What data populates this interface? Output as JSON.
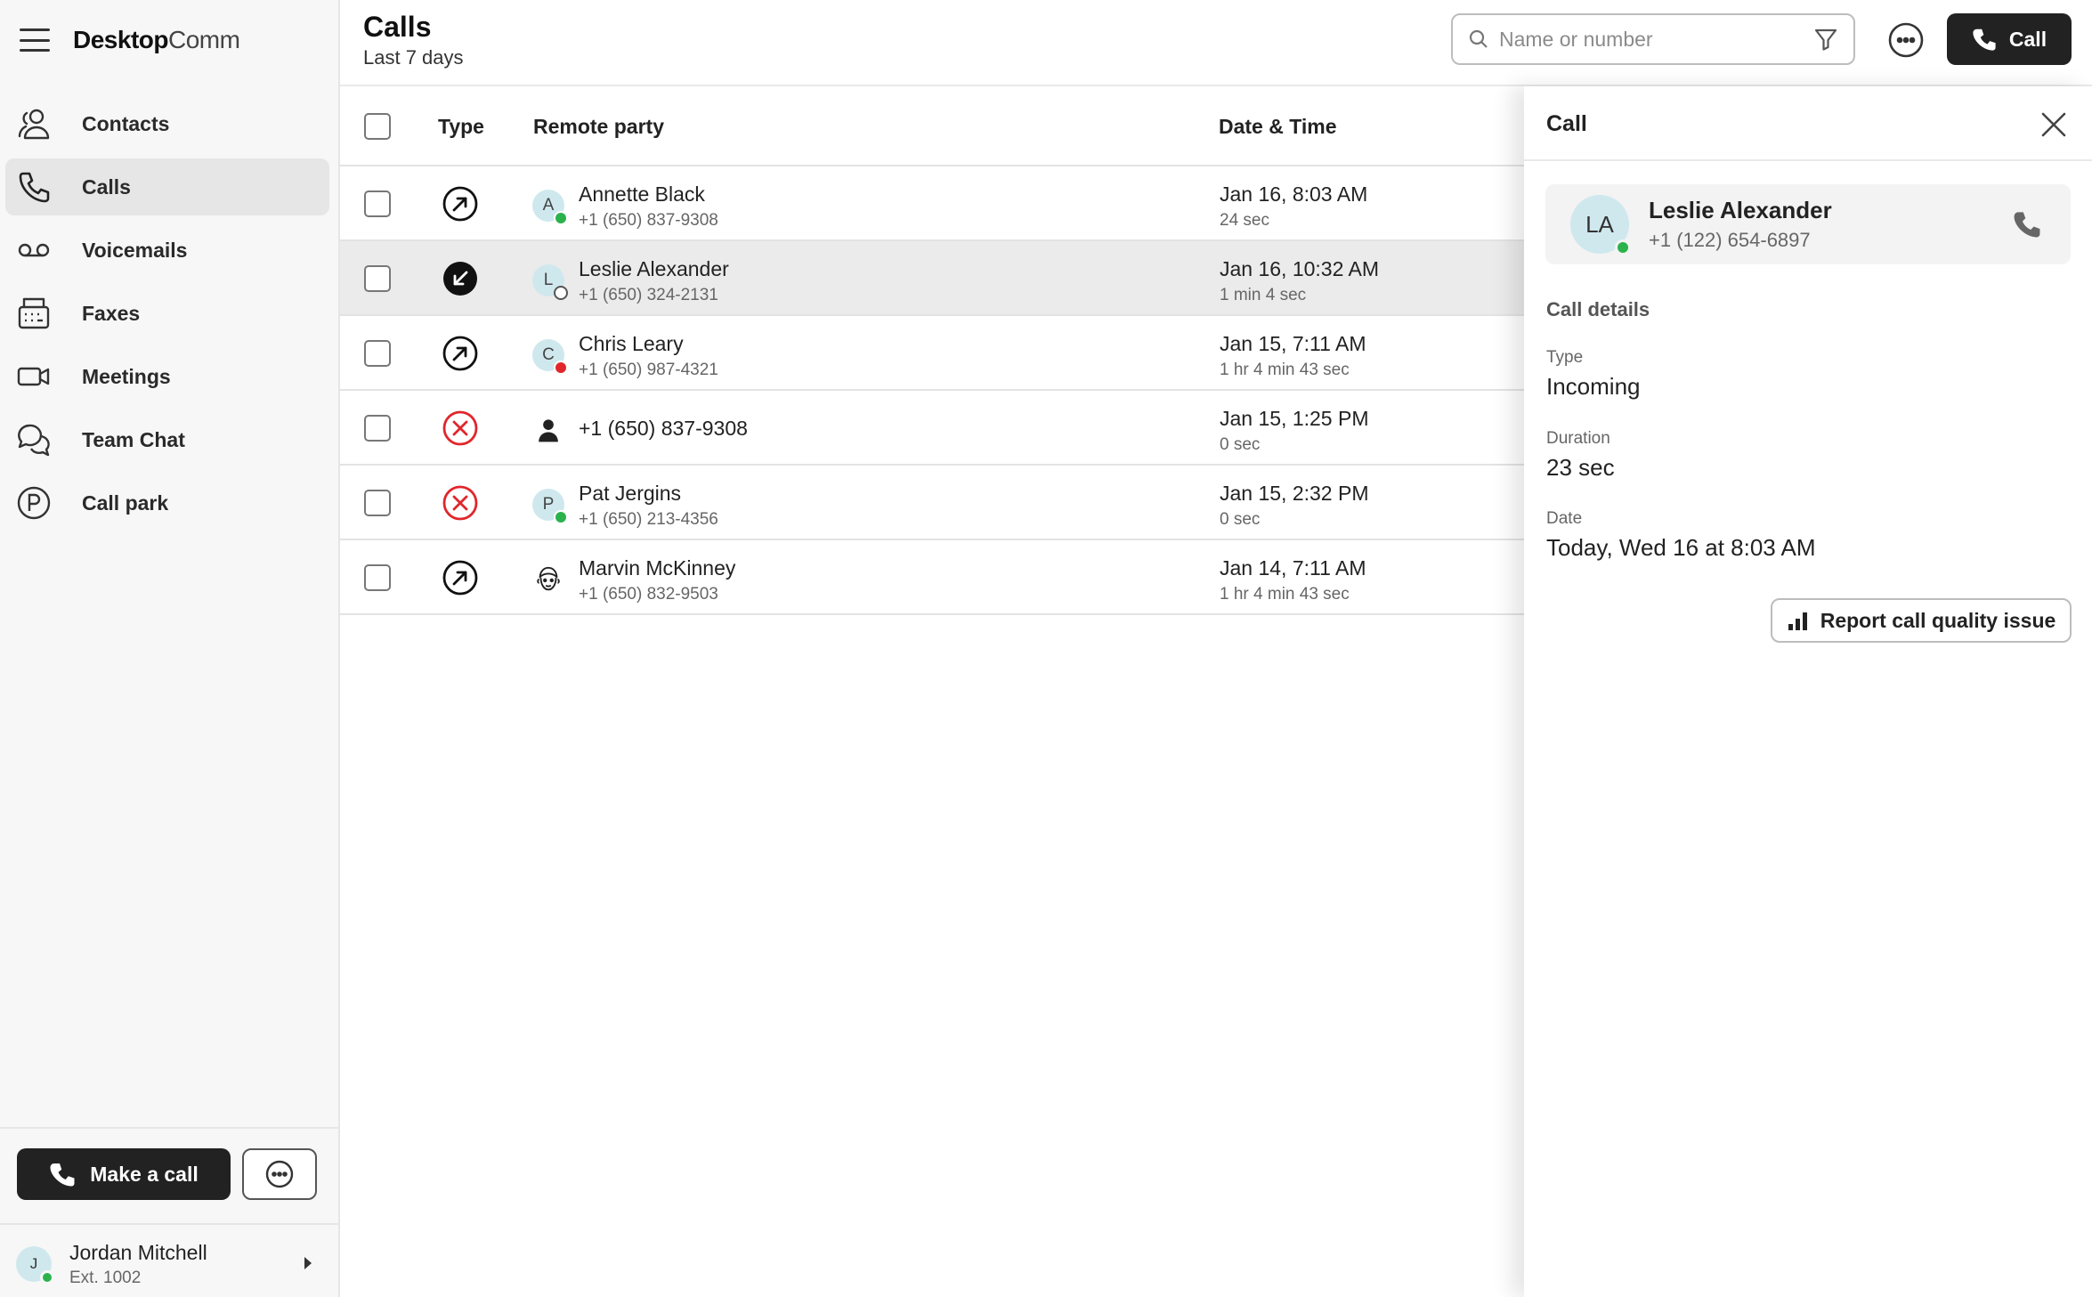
{
  "app": {
    "brand_bold": "Desktop",
    "brand_light": "Comm"
  },
  "sidebar": {
    "items": [
      {
        "label": "Contacts",
        "icon": "contacts-icon",
        "active": false
      },
      {
        "label": "Calls",
        "icon": "phone-icon",
        "active": true
      },
      {
        "label": "Voicemails",
        "icon": "voicemail-icon",
        "active": false
      },
      {
        "label": "Faxes",
        "icon": "fax-icon",
        "active": false
      },
      {
        "label": "Meetings",
        "icon": "video-icon",
        "active": false
      },
      {
        "label": "Team Chat",
        "icon": "chat-icon",
        "active": false
      },
      {
        "label": "Call park",
        "icon": "call-park-icon",
        "active": false
      }
    ],
    "make_call_label": "Make a call",
    "user": {
      "initial": "J",
      "name": "Jordan Mitchell",
      "ext": "Ext. 1002",
      "status": "online"
    }
  },
  "header": {
    "title": "Calls",
    "subtitle": "Last 7 days",
    "search_placeholder": "Name or number",
    "call_label": "Call"
  },
  "table": {
    "columns": {
      "type": "Type",
      "remote_party": "Remote party",
      "date_time": "Date & Time"
    },
    "rows": [
      {
        "type": "outgoing",
        "initial": "A",
        "status": "online",
        "name": "Annette Black",
        "number": "+1 (650) 837-9308",
        "datetime": "Jan 16, 8:03 AM",
        "duration": "24 sec",
        "selected": false
      },
      {
        "type": "incoming",
        "initial": "L",
        "status": "away",
        "name": "Leslie Alexander",
        "number": "+1 (650) 324-2131",
        "datetime": "Jan 16, 10:32 AM",
        "duration": "1 min 4 sec",
        "selected": true
      },
      {
        "type": "outgoing",
        "initial": "C",
        "status": "dnd",
        "name": "Chris Leary",
        "number": "+1 (650) 987-4321",
        "datetime": "Jan 15, 7:11 AM",
        "duration": "1 hr 4 min 43 sec",
        "selected": false
      },
      {
        "type": "missed",
        "initial": "",
        "status": "none",
        "name": "+1 (650) 837-9308",
        "number": "",
        "datetime": "Jan 15, 1:25 PM",
        "duration": "0 sec",
        "selected": false
      },
      {
        "type": "missed",
        "initial": "P",
        "status": "online",
        "name": "Pat Jergins",
        "number": "+1 (650) 213-4356",
        "datetime": "Jan 15, 2:32 PM",
        "duration": "0 sec",
        "selected": false
      },
      {
        "type": "outgoing",
        "initial": "",
        "status": "none",
        "name": "Marvin McKinney",
        "number": "+1 (650) 832-9503",
        "datetime": "Jan 14, 7:11 AM",
        "duration": "1 hr 4 min 43 sec",
        "selected": false
      }
    ]
  },
  "panel": {
    "title": "Call",
    "contact": {
      "initials": "LA",
      "name": "Leslie Alexander",
      "number": "+1 (122) 654-6897",
      "status": "online"
    },
    "section_title": "Call details",
    "type_label": "Type",
    "type_value": "Incoming",
    "duration_label": "Duration",
    "duration_value": "23 sec",
    "date_label": "Date",
    "date_value": "Today, Wed 16 at 8:03 AM",
    "report_label": "Report call quality issue"
  },
  "colors": {
    "accent_dark": "#222222",
    "online": "#2bb24c",
    "missed": "#e0262b",
    "avatar_bg": "#cfe8ee"
  }
}
